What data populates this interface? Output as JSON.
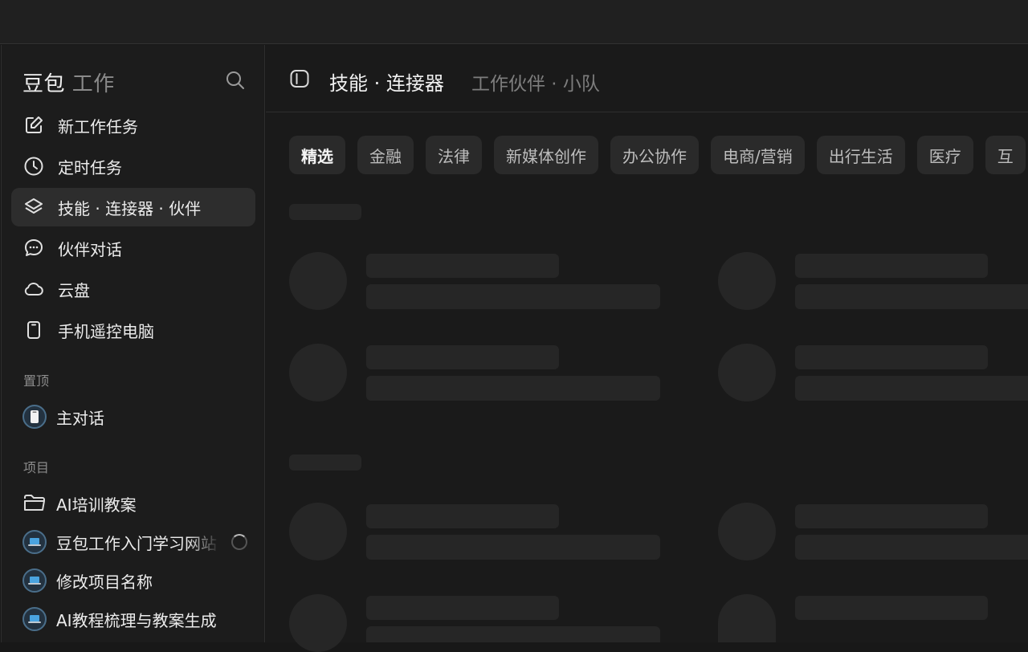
{
  "sidebar": {
    "brand_main": "豆包",
    "brand_sub": "工作",
    "nav": [
      {
        "label": "新工作任务",
        "icon": "edit-icon"
      },
      {
        "label": "定时任务",
        "icon": "clock-icon"
      },
      {
        "label": "技能 · 连接器 · 伙伴",
        "icon": "layers-icon",
        "active": true
      },
      {
        "label": "伙伴对话",
        "icon": "chat-icon"
      },
      {
        "label": "云盘",
        "icon": "cloud-icon"
      },
      {
        "label": "手机遥控电脑",
        "icon": "phone-icon"
      }
    ],
    "pinned_label": "置顶",
    "pinned": [
      {
        "label": "主对话",
        "icon": "phone-avatar-icon"
      }
    ],
    "projects_label": "项目",
    "projects": [
      {
        "label": "AI培训教案",
        "icon": "folder-icon"
      },
      {
        "label": "豆包工作入门学习网站",
        "icon": "laptop-avatar-icon",
        "loading": true
      },
      {
        "label": "修改项目名称",
        "icon": "laptop-avatar-icon"
      },
      {
        "label": "AI教程梳理与教案生成",
        "icon": "laptop-avatar-icon"
      }
    ]
  },
  "header": {
    "title": "技能 · 连接器",
    "subtitle": "工作伙伴 · 小队"
  },
  "chips": [
    "精选",
    "金融",
    "法律",
    "新媒体创作",
    "办公协作",
    "电商/营销",
    "出行生活",
    "医疗",
    "互"
  ],
  "active_chip": "精选"
}
